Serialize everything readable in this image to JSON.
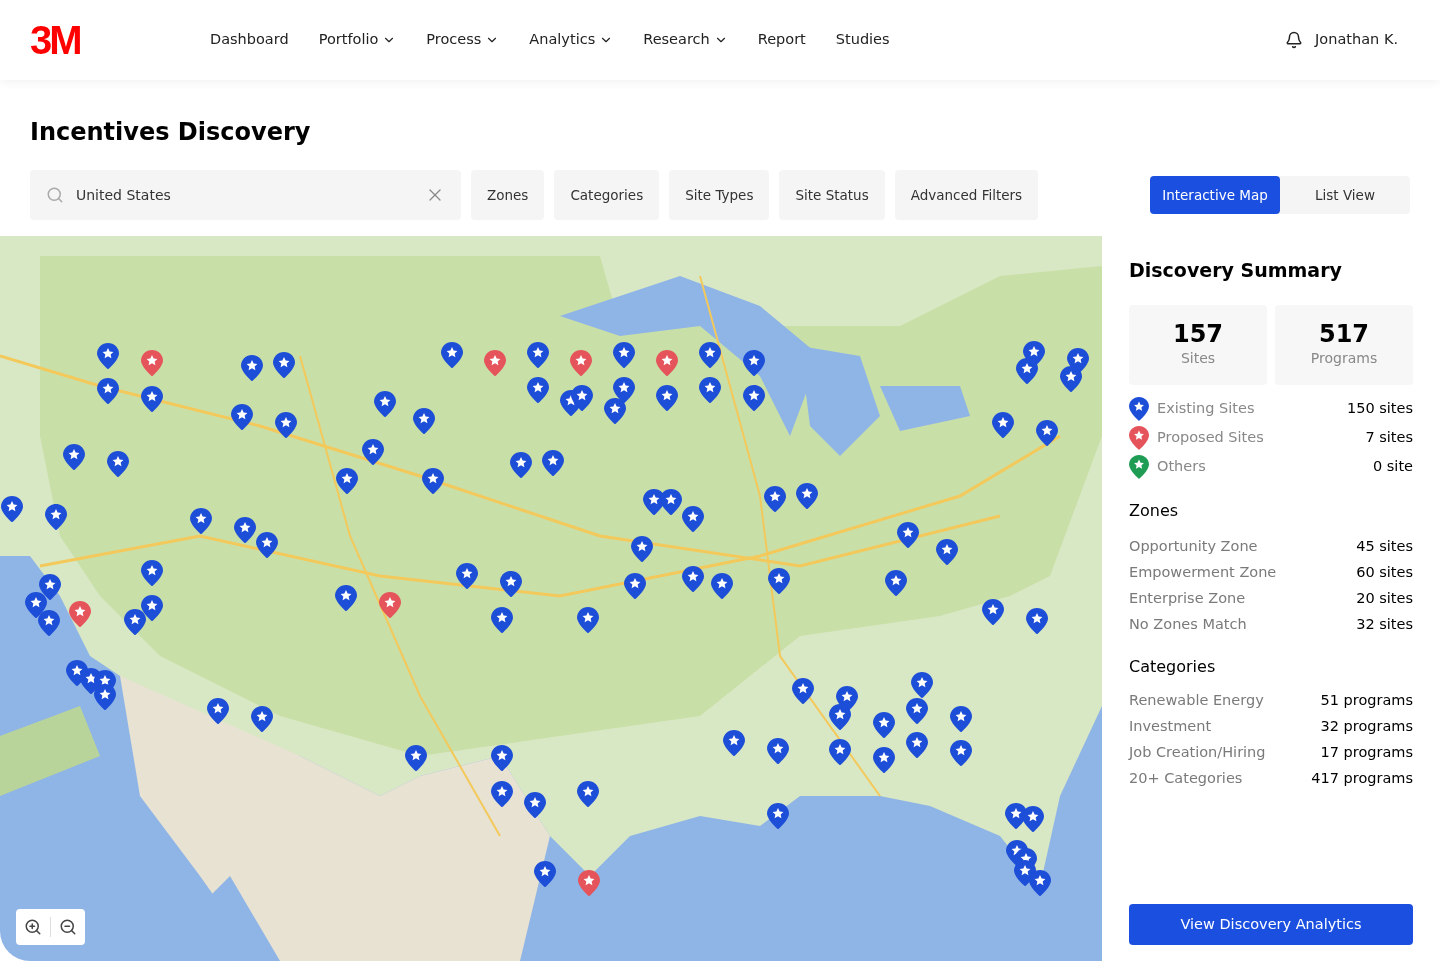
{
  "header": {
    "logo": "3M",
    "nav": [
      {
        "label": "Dashboard",
        "dropdown": false
      },
      {
        "label": "Portfolio",
        "dropdown": true
      },
      {
        "label": "Process",
        "dropdown": true
      },
      {
        "label": "Analytics",
        "dropdown": true
      },
      {
        "label": "Research",
        "dropdown": true
      },
      {
        "label": "Report",
        "dropdown": false
      },
      {
        "label": "Studies",
        "dropdown": false
      }
    ],
    "user": "Jonathan K."
  },
  "title": "Incentives Discovery",
  "search": {
    "value": "United States"
  },
  "filters": [
    "Zones",
    "Categories",
    "Site Types",
    "Site Status",
    "Advanced Filters"
  ],
  "views": [
    {
      "label": "Interactive Map",
      "selected": true
    },
    {
      "label": "List View",
      "selected": false
    }
  ],
  "summary": {
    "title": "Discovery Summary",
    "stats": [
      {
        "value": "157",
        "label": "Sites"
      },
      {
        "value": "517",
        "label": "Programs"
      }
    ],
    "legend": [
      {
        "label": "Existing Sites",
        "count": "150 sites",
        "color": "#1d4ed8"
      },
      {
        "label": "Proposed Sites",
        "count": "7 sites",
        "color": "#e5545a"
      },
      {
        "label": "Others",
        "count": "0 site",
        "color": "#1f9d55"
      }
    ],
    "zones": {
      "title": "Zones",
      "rows": [
        {
          "label": "Opportunity Zone",
          "value": "45 sites"
        },
        {
          "label": "Empowerment Zone",
          "value": "60 sites"
        },
        {
          "label": "Enterprise Zone",
          "value": "20 sites"
        },
        {
          "label": "No Zones Match",
          "value": "32 sites"
        }
      ]
    },
    "categories": {
      "title": "Categories",
      "rows": [
        {
          "label": "Renewable Energy",
          "value": "51 programs"
        },
        {
          "label": "Investment",
          "value": "32 programs"
        },
        {
          "label": "Job Creation/Hiring",
          "value": "17 programs"
        },
        {
          "label": "20+ Categories",
          "value": "417 programs"
        }
      ]
    },
    "button": "View Discovery Analytics"
  }
}
